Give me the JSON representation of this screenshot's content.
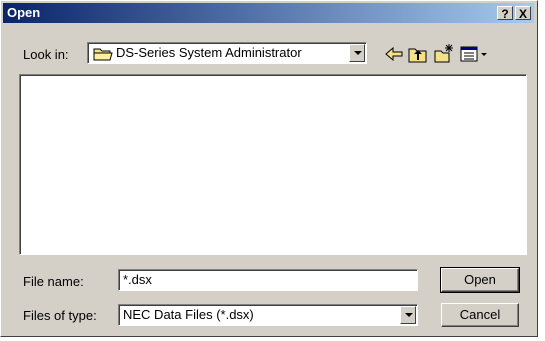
{
  "window": {
    "title": "Open",
    "help_label": "?",
    "close_label": "X"
  },
  "look_in": {
    "label": "Look in:",
    "value": "DS-Series System Administrator"
  },
  "toolbar": {
    "icons": [
      "back-arrow-icon",
      "up-one-level-icon",
      "new-folder-icon",
      "view-menu-icon"
    ]
  },
  "file_list": {
    "items": []
  },
  "file_name": {
    "label": "File name:",
    "value": "*.dsx"
  },
  "files_of_type": {
    "label": "Files of type:",
    "value": "NEC Data Files (*.dsx)"
  },
  "buttons": {
    "open": "Open",
    "cancel": "Cancel"
  }
}
